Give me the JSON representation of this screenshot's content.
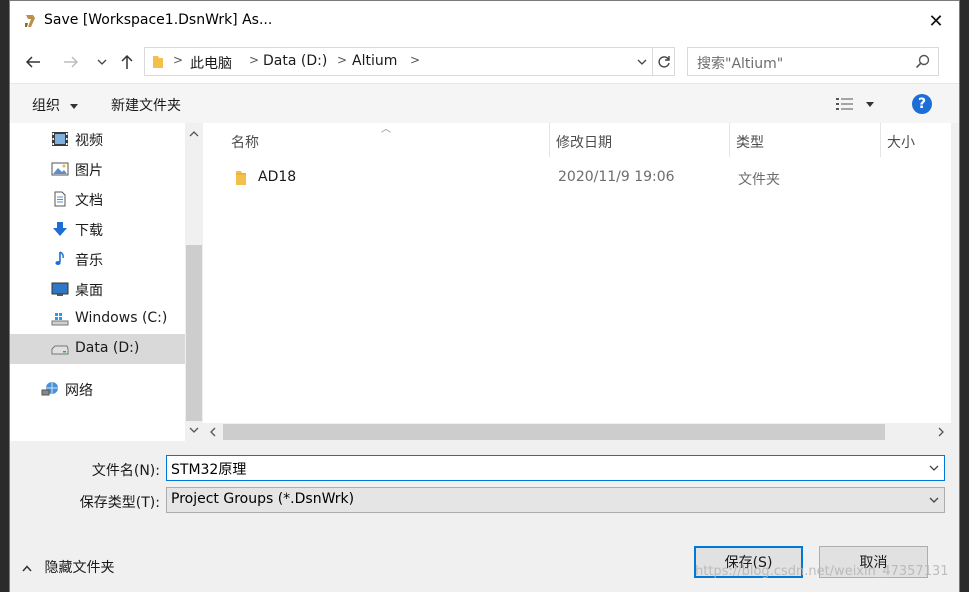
{
  "window": {
    "title": "Save [Workspace1.DsnWrk] As...",
    "close_glyph": "✕"
  },
  "nav": {
    "breadcrumbs": [
      "此电脑",
      "Data (D:)",
      "Altium"
    ],
    "search_placeholder": "搜索\"Altium\""
  },
  "toolbar": {
    "organize_label": "组织",
    "new_folder_label": "新建文件夹"
  },
  "sidebar": {
    "items": [
      {
        "label": "视频",
        "icon": "video-icon"
      },
      {
        "label": "图片",
        "icon": "pictures-icon"
      },
      {
        "label": "文档",
        "icon": "documents-icon"
      },
      {
        "label": "下载",
        "icon": "download-icon"
      },
      {
        "label": "音乐",
        "icon": "music-icon"
      },
      {
        "label": "桌面",
        "icon": "desktop-icon"
      },
      {
        "label": "Windows (C:)",
        "icon": "drive-c-icon"
      },
      {
        "label": "Data (D:)",
        "icon": "drive-d-icon",
        "selected": true
      },
      {
        "label": "网络",
        "icon": "network-icon"
      }
    ]
  },
  "file_list": {
    "columns": [
      "名称",
      "修改日期",
      "类型",
      "大小"
    ],
    "rows": [
      {
        "name": "AD18",
        "modified": "2020/11/9 19:06",
        "type": "文件夹",
        "size": ""
      }
    ]
  },
  "form": {
    "filename_label": "文件名(N):",
    "filename_value": "STM32原理",
    "filetype_label": "保存类型(T):",
    "filetype_value": "Project Groups (*.DsnWrk)"
  },
  "footer": {
    "hide_folders_label": "隐藏文件夹",
    "save_label": "保存(S)",
    "cancel_label": "取消"
  },
  "watermark": "https://blog.csdn.net/weixin_47357131",
  "colors": {
    "accent": "#0078d7",
    "help": "#1c6ed6",
    "folder": "#f3c04b"
  }
}
